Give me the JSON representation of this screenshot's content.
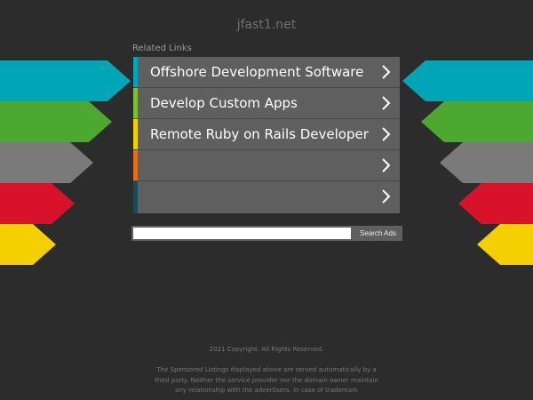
{
  "site": {
    "domain": "jfast1.net"
  },
  "related_links": {
    "heading": "Related Links",
    "items": [
      {
        "label": "Offshore Development Software",
        "accent": "#00a6b5",
        "icon": "chevron-right-icon"
      },
      {
        "label": "Develop Custom Apps",
        "accent": "#7cbf36",
        "icon": "chevron-right-icon"
      },
      {
        "label": "Remote Ruby on Rails Developer",
        "accent": "#f0d000",
        "icon": "chevron-right-icon"
      },
      {
        "label": "",
        "accent": "#e07020",
        "icon": "chevron-right-icon"
      },
      {
        "label": "",
        "accent": "#1a4a5a",
        "icon": "chevron-right-icon"
      }
    ]
  },
  "decorative_arrows": {
    "colors": [
      "#00a6b5",
      "#4da832",
      "#7a7a7a",
      "#d9122b",
      "#f5d000"
    ]
  },
  "search": {
    "input_value": "",
    "button_label": "Search Ads"
  },
  "footer": {
    "copyright": "2021 Copyright. All Rights Reserved.",
    "disclaimer": "The Sponsored Listings displayed above are served automatically by a third party. Neither the service provider nor the domain owner maintain any relationship with the advertisers. In case of trademark"
  },
  "colors": {
    "background": "#2c2c2c",
    "panel": "#5f5f5f",
    "text": "#ffffff"
  }
}
